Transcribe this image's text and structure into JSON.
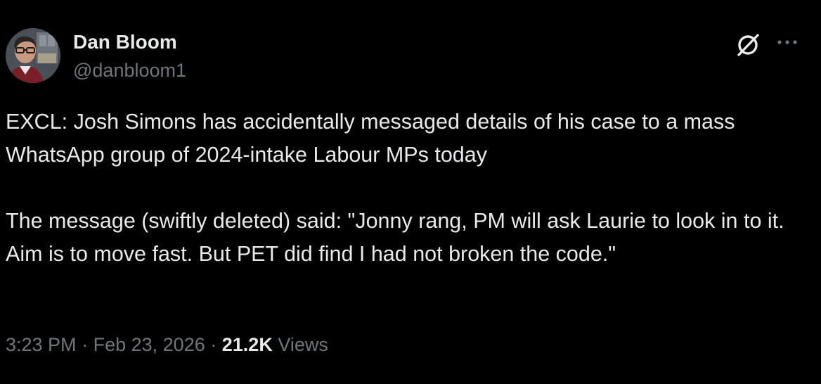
{
  "author": {
    "display_name": "Dan Bloom",
    "handle": "@danbloom1",
    "avatar_icon": "avatar-photo"
  },
  "header_actions": {
    "grok_icon": "grok-slash-icon",
    "more_icon": "more-horizontal-icon"
  },
  "tweet": {
    "paragraphs": [
      "EXCL: Josh Simons has accidentally messaged details of his case to a mass WhatsApp group of 2024-intake Labour MPs today",
      "The message (swiftly deleted) said: \"Jonny rang, PM will ask Laurie to look in to it. Aim is to move fast. But PET did find I had not broken the code.\""
    ]
  },
  "meta": {
    "time": "3:23 PM",
    "separator": "·",
    "date": "Feb 23, 2026",
    "views_count": "21.2K",
    "views_label": "Views"
  },
  "colors": {
    "background": "#000000",
    "primary_text": "#e7e9ea",
    "secondary_text": "#71767b"
  }
}
